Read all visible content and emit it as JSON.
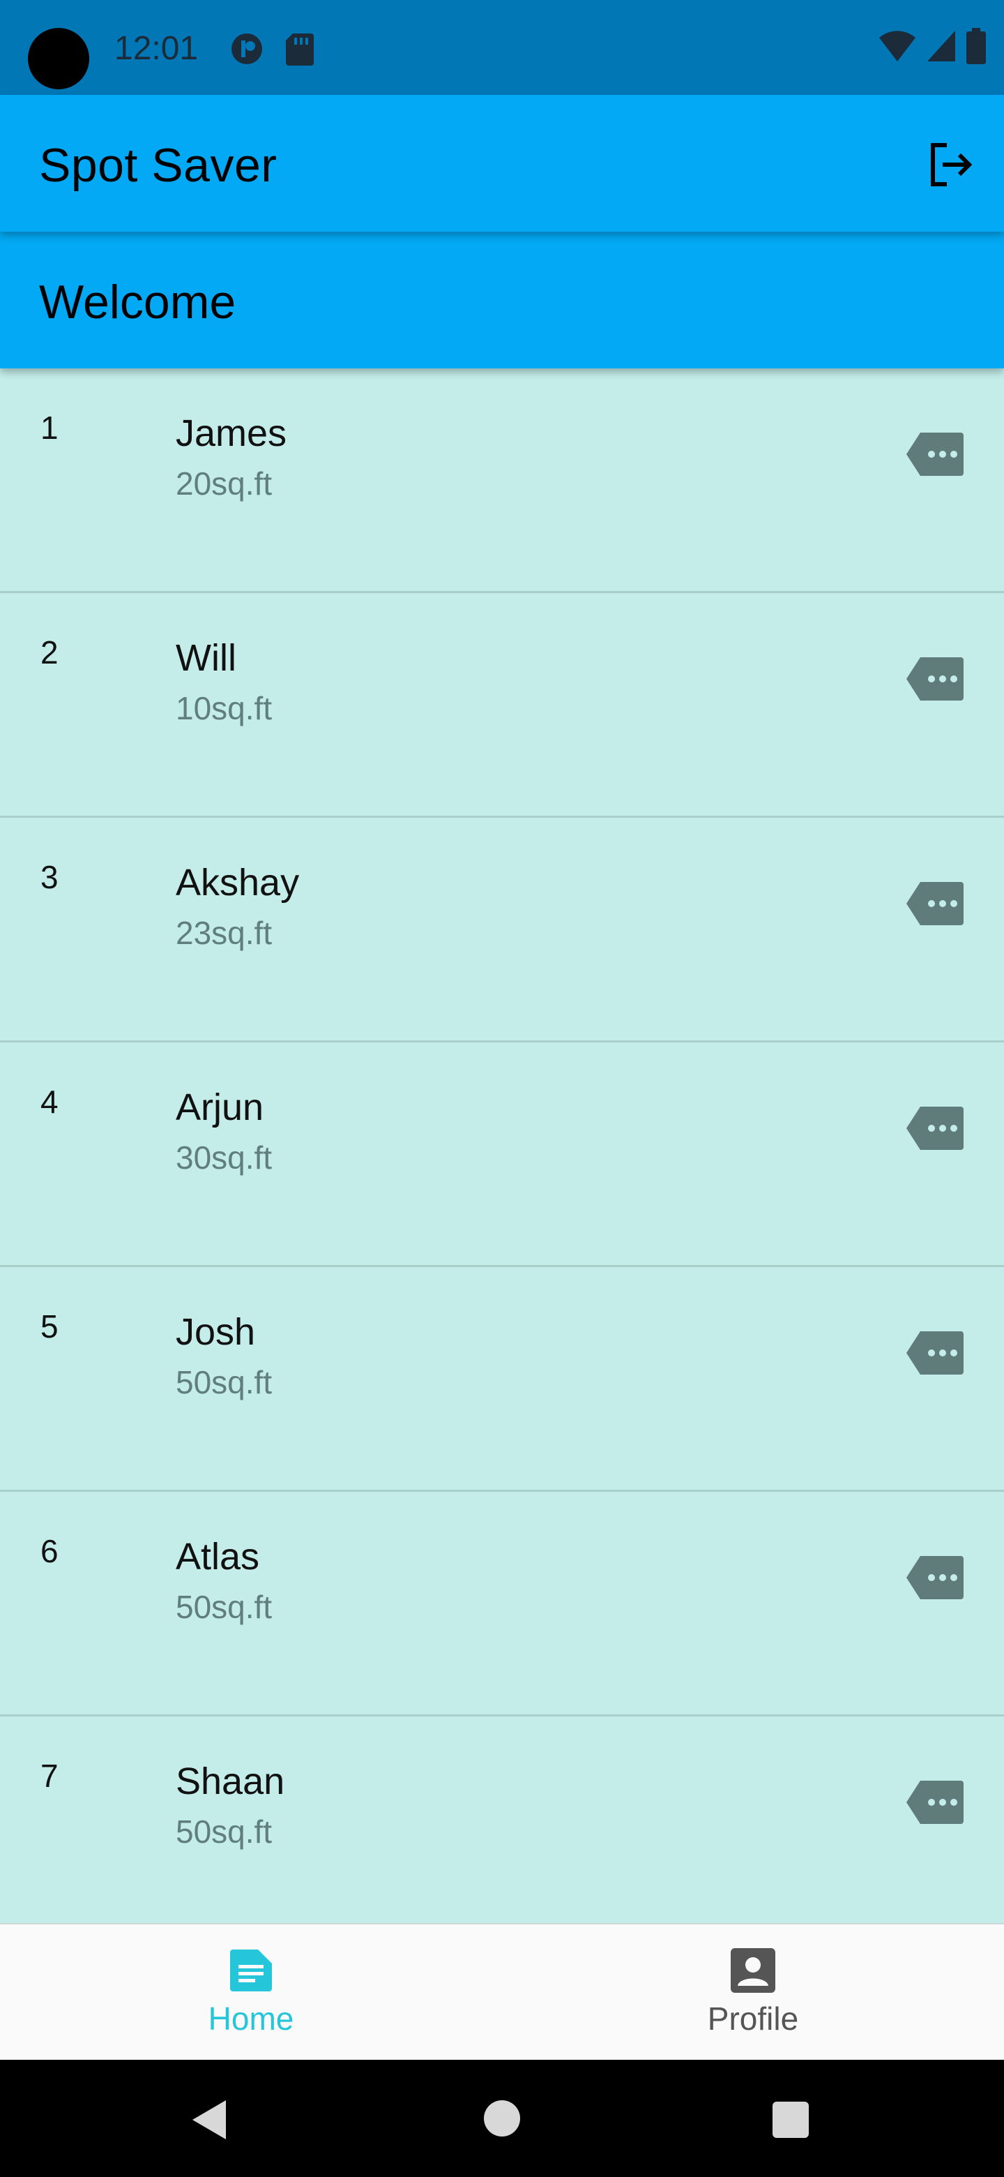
{
  "status_bar": {
    "time": "12:01"
  },
  "app_bar": {
    "title": "Spot Saver"
  },
  "header": {
    "welcome": "Welcome"
  },
  "spots": [
    {
      "index": "1",
      "name": "James",
      "area": "20sq.ft"
    },
    {
      "index": "2",
      "name": "Will",
      "area": "10sq.ft"
    },
    {
      "index": "3",
      "name": "Akshay",
      "area": "23sq.ft"
    },
    {
      "index": "4",
      "name": "Arjun",
      "area": "30sq.ft"
    },
    {
      "index": "5",
      "name": "Josh",
      "area": "50sq.ft"
    },
    {
      "index": "6",
      "name": "Atlas",
      "area": "50sq.ft"
    },
    {
      "index": "7",
      "name": "Shaan",
      "area": "50sq.ft"
    }
  ],
  "bottom_nav": {
    "items": [
      {
        "label": "Home",
        "icon": "document-icon",
        "active": true
      },
      {
        "label": "Profile",
        "icon": "account-box-icon",
        "active": false
      }
    ]
  },
  "colors": {
    "status_bar": "#0277b6",
    "app_bar": "#03a9f4",
    "list_bg": "#c4ede9",
    "accent": "#26c6da"
  }
}
